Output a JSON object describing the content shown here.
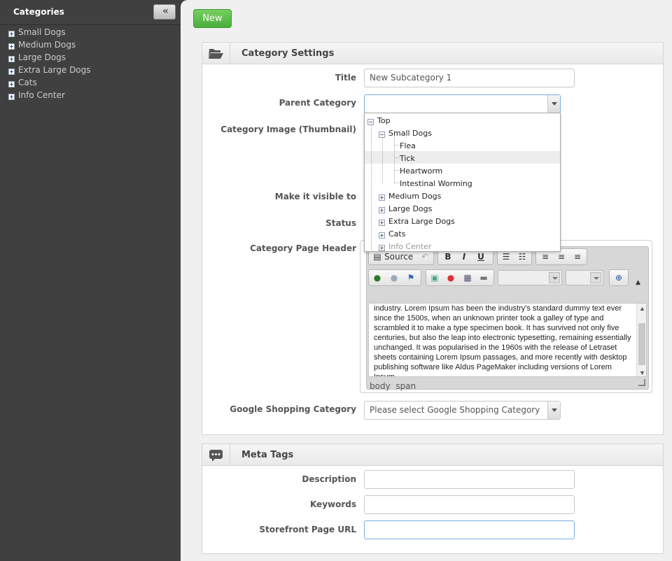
{
  "sidebar": {
    "title": "Categories",
    "collapse_label": "«",
    "items": [
      {
        "label": "Small Dogs"
      },
      {
        "label": "Medium Dogs"
      },
      {
        "label": "Large Dogs"
      },
      {
        "label": "Extra Large Dogs"
      },
      {
        "label": "Cats"
      },
      {
        "label": "Info Center"
      }
    ]
  },
  "toolbar": {
    "new_label": "New"
  },
  "settings": {
    "title": "Category Settings",
    "title_label": "Title",
    "title_value": "New Subcategory 1",
    "parent_label": "Parent Category",
    "parent_value": "",
    "image_label": "Category Image (Thumbnail)",
    "visible_label": "Make it visible to",
    "status_label": "Status",
    "header_label": "Category Page Header",
    "google_label": "Google Shopping Category",
    "google_value": "Please select Google Shopping Category"
  },
  "tree": {
    "top": "Top",
    "small_dogs": "Small Dogs",
    "children": [
      "Flea",
      "Tick",
      "Heartworm",
      "Intestinal Worming"
    ],
    "others": [
      "Medium Dogs",
      "Large Dogs",
      "Extra Large Dogs",
      "Cats",
      "Info Center"
    ]
  },
  "editor": {
    "source_label": "Source",
    "bold": "B",
    "italic": "I",
    "underline": "U",
    "content": "industry. Lorem Ipsum has been the industry's standard dummy text ever since the 1500s, when an unknown printer took a galley of type and scrambled it to make a type specimen book. It has survived not only five centuries, but also the leap into electronic typesetting, remaining essentially unchanged. It was popularised in the 1960s with the release of Letraset sheets containing Lorem Ipsum passages, and more recently with desktop publishing software like Aldus PageMaker including versions of Lorem Ipsum.",
    "path_body": "body",
    "path_span": "span"
  },
  "meta": {
    "title": "Meta Tags",
    "description_label": "Description",
    "keywords_label": "Keywords",
    "url_label": "Storefront Page URL"
  }
}
